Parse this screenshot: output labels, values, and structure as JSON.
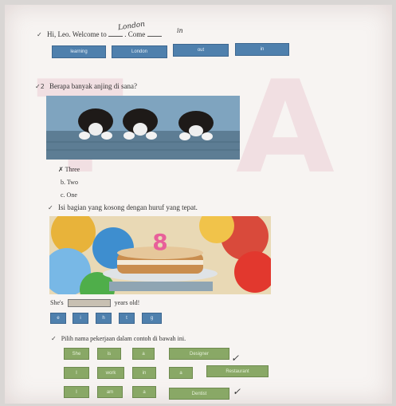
{
  "q1": {
    "text_before": "Hi, Leo. Welcome to",
    "handwritten_answer": "London",
    "text_after": ". Come",
    "handwritten_answer2": "in",
    "options": [
      "learning",
      "London",
      "out",
      "in"
    ]
  },
  "q2": {
    "prompt": "Berapa banyak anjing di sana?",
    "options": [
      "Three",
      "b. Two",
      "c. One"
    ]
  },
  "q3": {
    "prompt": "Isi bagian yang kosong dengan huruf yang tepat.",
    "sentence_before": "She's",
    "sentence_after": "years old!",
    "letter_tiles": [
      "e",
      "i",
      "h",
      "t",
      "g"
    ],
    "cake_number": "8"
  },
  "q4": {
    "prompt": "Pilih nama pekerjaan dalam contoh di bawah ini.",
    "rows": [
      [
        "She",
        "is",
        "a",
        "Designer"
      ],
      [
        "I",
        "work",
        "in",
        "a",
        "Restaurant"
      ],
      [
        "I",
        "am",
        "a",
        "Dentist"
      ]
    ]
  },
  "colors": {
    "blue_button": "#4f80ad",
    "green_button": "#89a866"
  }
}
